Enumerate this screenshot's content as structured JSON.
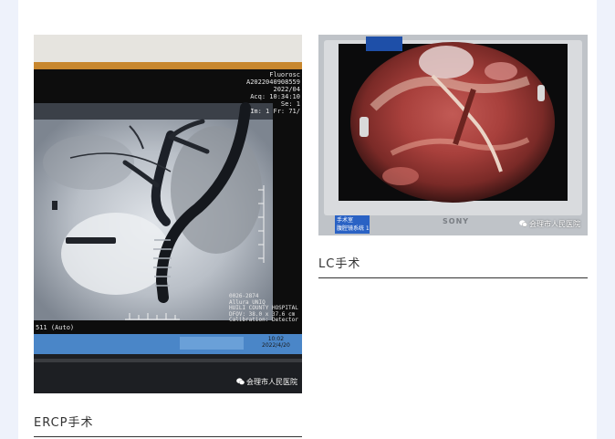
{
  "gallery": {
    "left": {
      "caption": "ERCP手术",
      "watermark": "会理市人民医院",
      "screen_text": {
        "header_lines": [
          "Fluorosc",
          "A2022040908559",
          "2022/04",
          "Acq: 10:34:10",
          "Se: 1",
          "Im: 1  Fr: 71/"
        ],
        "footer_lines": [
          "0026-2874",
          "Allura UNIQ",
          "HUILI COUNTY HOSPITAL",
          "DFOV: 38.0 x 37.6 cm",
          "Calibration: Detector"
        ],
        "left_label": "511 (Auto)",
        "clock_time": "10:02",
        "clock_date": "2022/4/20"
      }
    },
    "right": {
      "caption": "LC手术",
      "watermark": "会理市人民医院",
      "monitor_brand": "SONY",
      "sticker_line1": "手术室",
      "sticker_line2": "腹腔镜系统 1"
    }
  },
  "colors": {
    "page_bg": "#eef2fb",
    "card_bg": "#ffffff",
    "caption_text": "#333333"
  }
}
